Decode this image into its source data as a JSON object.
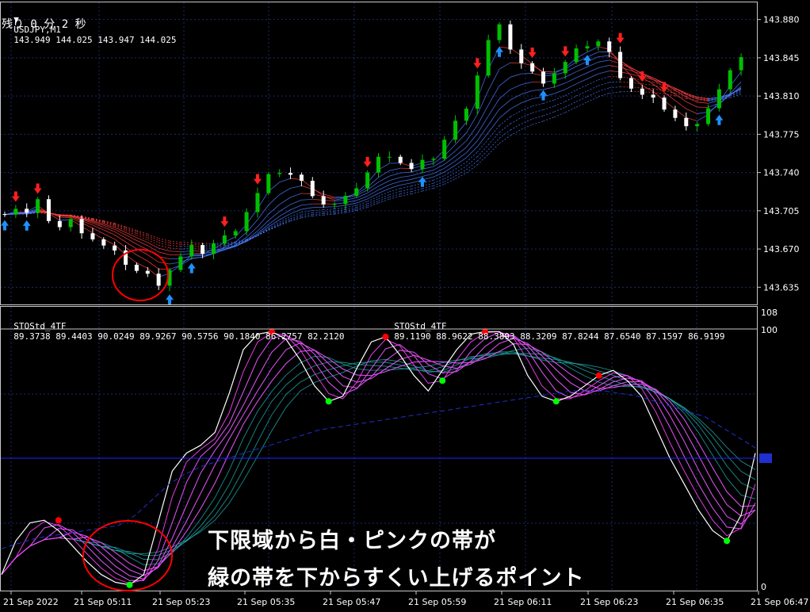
{
  "header": {
    "triangle": "▼",
    "symbol": "USDJPY,M1",
    "ohlc": "143.949 144.025 143.947 144.025",
    "remaining": "残り 0 分 2 秒"
  },
  "indicator_header": {
    "name1": "STOStd_4TF",
    "values1": "89.3738 89.4403 90.0249 89.9267 90.5756 90.1840 86.2757 82.2120",
    "name2": "STOStd_4TF",
    "values2": "89.1190 88.9622 88.3893 88.3209 87.8244 87.6540 87.1597 86.9199"
  },
  "annotation": {
    "line1": "下限域から白・ピンクの帯が",
    "line2": "緑の帯を下からすくい上げるポイント"
  },
  "colors": {
    "background": "#000000",
    "grid": "#1c2a6e",
    "bull_candle": "#00c000",
    "bear_candle": "#ffffff",
    "up_arrow": "#1e90ff",
    "down_arrow": "#ff2020",
    "ma_ribbon_up": "#4c7cff",
    "ma_ribbon_down": "#ff4040",
    "stoch_main": "#ffffff",
    "stoch_pink": "#ff40ff",
    "stoch_teal": "#20b0b0",
    "level_line": "#2020ff",
    "circle": "#ff0000",
    "dot_red": "#ff0000",
    "dot_green": "#00ff00"
  },
  "chart_data": [
    {
      "type": "candlestick",
      "title": "USDJPY,M1",
      "ylim": [
        143.62,
        143.895
      ],
      "y_ticks": [
        "143.880",
        "143.845",
        "143.810",
        "143.775",
        "143.740",
        "143.705",
        "143.670",
        "143.635"
      ],
      "y_tick_values": [
        143.88,
        143.845,
        143.81,
        143.775,
        143.74,
        143.705,
        143.67,
        143.635
      ],
      "close_path": [
        143.705,
        143.708,
        143.702,
        143.712,
        143.698,
        143.69,
        143.695,
        143.688,
        143.68,
        143.672,
        143.665,
        143.658,
        143.65,
        143.645,
        143.64,
        143.652,
        143.662,
        143.67,
        143.668,
        143.675,
        143.68,
        143.69,
        143.705,
        143.72,
        143.735,
        143.742,
        143.738,
        143.73,
        143.722,
        143.712,
        143.71,
        143.715,
        143.728,
        143.74,
        143.752,
        143.758,
        143.75,
        143.742,
        143.748,
        143.755,
        143.77,
        143.785,
        143.802,
        143.83,
        143.86,
        143.872,
        143.855,
        143.84,
        143.83,
        143.825,
        143.832,
        143.84,
        143.85,
        143.858,
        143.86,
        143.848,
        143.83,
        143.818,
        143.81,
        143.805,
        143.8,
        143.79,
        143.78,
        143.788,
        143.8,
        143.815,
        143.83,
        143.848
      ],
      "signals": [
        {
          "type": "up",
          "index": 0
        },
        {
          "type": "down",
          "index": 1
        },
        {
          "type": "up",
          "index": 2
        },
        {
          "type": "down",
          "index": 3
        },
        {
          "type": "up",
          "index": 15
        },
        {
          "type": "up",
          "index": 17
        },
        {
          "type": "down",
          "index": 20
        },
        {
          "type": "down",
          "index": 23
        },
        {
          "type": "down",
          "index": 33
        },
        {
          "type": "up",
          "index": 38
        },
        {
          "type": "down",
          "index": 43
        },
        {
          "type": "up",
          "index": 45
        },
        {
          "type": "down",
          "index": 48
        },
        {
          "type": "up",
          "index": 49
        },
        {
          "type": "down",
          "index": 51
        },
        {
          "type": "up",
          "index": 53
        },
        {
          "type": "down",
          "index": 56
        },
        {
          "type": "down",
          "index": 58
        },
        {
          "type": "down",
          "index": 60
        },
        {
          "type": "up",
          "index": 65
        }
      ]
    },
    {
      "type": "line",
      "title": "STOStd_4TF",
      "ylim": [
        0,
        100
      ],
      "y_ticks": [
        "108",
        "100",
        "0"
      ],
      "level_line": 50,
      "x_tick_labels": [
        "21 Sep 2022",
        "21 Sep 05:11",
        "21 Sep 05:23",
        "21 Sep 05:35",
        "21 Sep 05:47",
        "21 Sep 05:59",
        "21 Sep 06:11",
        "21 Sep 06:23",
        "21 Sep 06:35",
        "21 Sep 06:47"
      ],
      "main_series": [
        5,
        18,
        25,
        26,
        22,
        16,
        10,
        5,
        2,
        1,
        5,
        25,
        45,
        52,
        55,
        60,
        75,
        92,
        98,
        99,
        96,
        88,
        78,
        72,
        74,
        85,
        95,
        97,
        90,
        82,
        76,
        84,
        92,
        98,
        99,
        99,
        94,
        82,
        74,
        72,
        74,
        78,
        82,
        84,
        80,
        74,
        62,
        50,
        40,
        30,
        22,
        18,
        28,
        52
      ],
      "slow_series": [
        15,
        17,
        19,
        20,
        21,
        22,
        23,
        24,
        28,
        34,
        40,
        44,
        47,
        49,
        51,
        53,
        55,
        57,
        59,
        61,
        62,
        63,
        64,
        65,
        66,
        67,
        68,
        69,
        70,
        71,
        72,
        73,
        74,
        75,
        76,
        76,
        76,
        75,
        74,
        72,
        70,
        68,
        66,
        62,
        58,
        54
      ],
      "dots": [
        {
          "color": "red",
          "index": 4,
          "value": 26
        },
        {
          "color": "green",
          "index": 9,
          "value": 1
        },
        {
          "color": "red",
          "index": 19,
          "value": 99
        },
        {
          "color": "green",
          "index": 23,
          "value": 72
        },
        {
          "color": "red",
          "index": 27,
          "value": 97
        },
        {
          "color": "green",
          "index": 31,
          "value": 80
        },
        {
          "color": "red",
          "index": 34,
          "value": 99
        },
        {
          "color": "green",
          "index": 39,
          "value": 72
        },
        {
          "color": "red",
          "index": 42,
          "value": 82
        },
        {
          "color": "green",
          "index": 51,
          "value": 18
        }
      ]
    }
  ]
}
